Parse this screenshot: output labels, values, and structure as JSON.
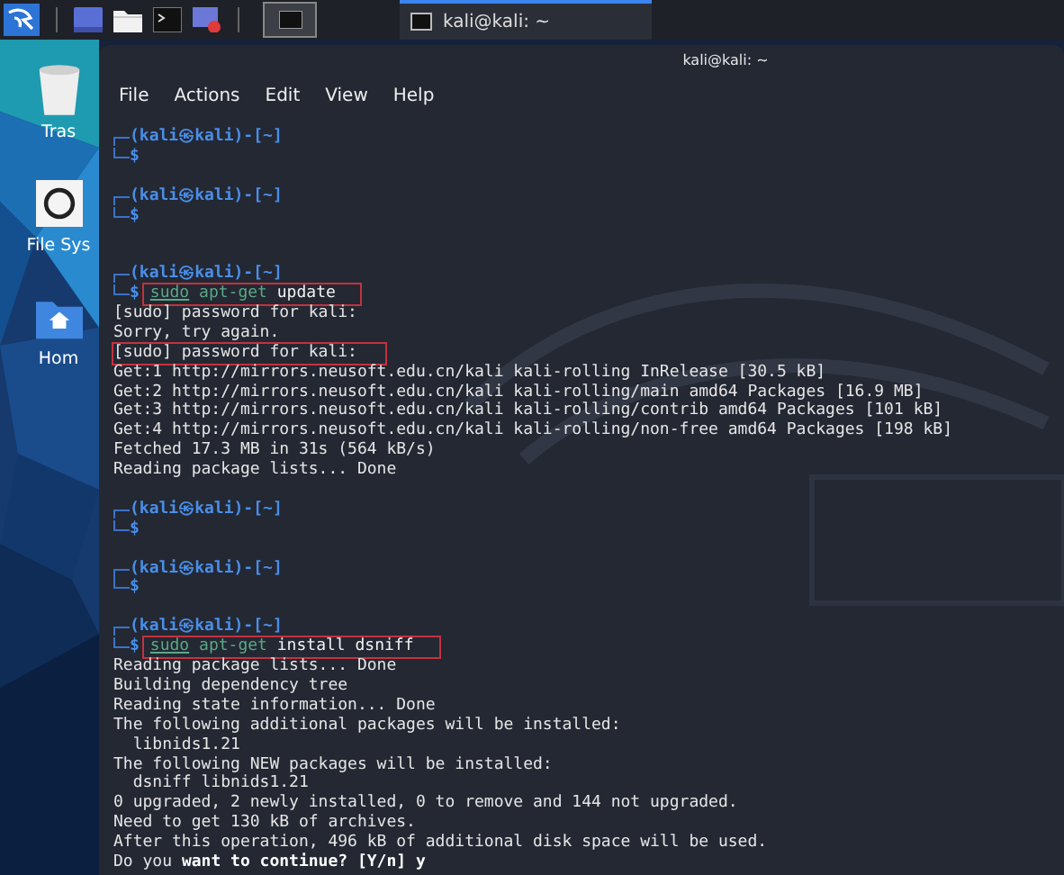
{
  "taskbar": {
    "launchers": [
      {
        "kind": "desktop"
      },
      {
        "kind": "files"
      },
      {
        "kind": "terminal"
      },
      {
        "kind": "recorder"
      }
    ],
    "workspaces": [
      {
        "selected": true
      }
    ],
    "tasks": [
      {
        "title": "kali@kali: ~",
        "selected": true
      }
    ]
  },
  "desktop_icons": [
    {
      "label": "Tras",
      "kind": "trash"
    },
    {
      "label": "File Sys",
      "kind": "drive"
    },
    {
      "label": "Hom",
      "kind": "home"
    }
  ],
  "window": {
    "title": "kali@kali: ~",
    "menu": [
      "File",
      "Actions",
      "Edit",
      "View",
      "Help"
    ]
  },
  "terminal": {
    "lines": [
      {
        "kind": "prompt",
        "header": "(kali㉿kali)-[~]",
        "symbol": "$"
      },
      {
        "kind": "blank"
      },
      {
        "kind": "prompt",
        "header": "(kali㉿kali)-[~]",
        "symbol": "$"
      },
      {
        "kind": "blank"
      },
      {
        "kind": "blank"
      },
      {
        "kind": "prompt",
        "header": "(kali㉿kali)-[~]",
        "symbol": "$",
        "highlighted": true,
        "command": [
          {
            "text": "sudo",
            "kind": "sudo"
          },
          {
            "text": "apt-get",
            "kind": "program"
          },
          {
            "text": "update",
            "kind": "arg"
          }
        ]
      },
      {
        "kind": "output",
        "text": "[sudo] password for kali:",
        "highlighted": false
      },
      {
        "kind": "output",
        "text": "Sorry, try again.",
        "highlighted": false
      },
      {
        "kind": "output",
        "text": "[sudo] password for kali:",
        "highlighted": true
      },
      {
        "kind": "output",
        "text": "Get:1 http://mirrors.neusoft.edu.cn/kali kali-rolling InRelease [30.5 kB]",
        "highlighted": false
      },
      {
        "kind": "output",
        "text": "Get:2 http://mirrors.neusoft.edu.cn/kali kali-rolling/main amd64 Packages [16.9 MB]",
        "highlighted": false
      },
      {
        "kind": "output",
        "text": "Get:3 http://mirrors.neusoft.edu.cn/kali kali-rolling/contrib amd64 Packages [101 kB]",
        "highlighted": false
      },
      {
        "kind": "output",
        "text": "Get:4 http://mirrors.neusoft.edu.cn/kali kali-rolling/non-free amd64 Packages [198 kB]",
        "highlighted": false
      },
      {
        "kind": "output",
        "text": "Fetched 17.3 MB in 31s (564 kB/s)",
        "highlighted": false
      },
      {
        "kind": "output",
        "text": "Reading package lists... Done",
        "highlighted": false
      },
      {
        "kind": "blank"
      },
      {
        "kind": "prompt",
        "header": "(kali㉿kali)-[~]",
        "symbol": "$"
      },
      {
        "kind": "blank"
      },
      {
        "kind": "prompt",
        "header": "(kali㉿kali)-[~]",
        "symbol": "$"
      },
      {
        "kind": "blank"
      },
      {
        "kind": "prompt",
        "header": "(kali㉿kali)-[~]",
        "symbol": "$",
        "highlighted": true,
        "command": [
          {
            "text": "sudo",
            "kind": "sudo"
          },
          {
            "text": "apt-get",
            "kind": "program"
          },
          {
            "text": "install dsniff",
            "kind": "arg"
          }
        ]
      },
      {
        "kind": "output",
        "text": "Reading package lists... Done",
        "highlighted": false
      },
      {
        "kind": "output",
        "text": "Building dependency tree",
        "highlighted": false
      },
      {
        "kind": "output",
        "text": "Reading state information... Done",
        "highlighted": false
      },
      {
        "kind": "output",
        "text": "The following additional packages will be installed:",
        "highlighted": false
      },
      {
        "kind": "output",
        "text": "  libnids1.21",
        "highlighted": false
      },
      {
        "kind": "output",
        "text": "The following NEW packages will be installed:",
        "highlighted": false
      },
      {
        "kind": "output",
        "text": "  dsniff libnids1.21",
        "highlighted": false
      },
      {
        "kind": "output",
        "text": "0 upgraded, 2 newly installed, 0 to remove and 144 not upgraded.",
        "highlighted": false
      },
      {
        "kind": "output",
        "text": "Need to get 130 kB of archives.",
        "highlighted": false
      },
      {
        "kind": "output",
        "text": "After this operation, 496 kB of additional disk space will be used.",
        "highlighted": false
      },
      {
        "kind": "output",
        "text": "Do you **want to continue? [Y/n] y**",
        "highlighted": false
      }
    ]
  }
}
